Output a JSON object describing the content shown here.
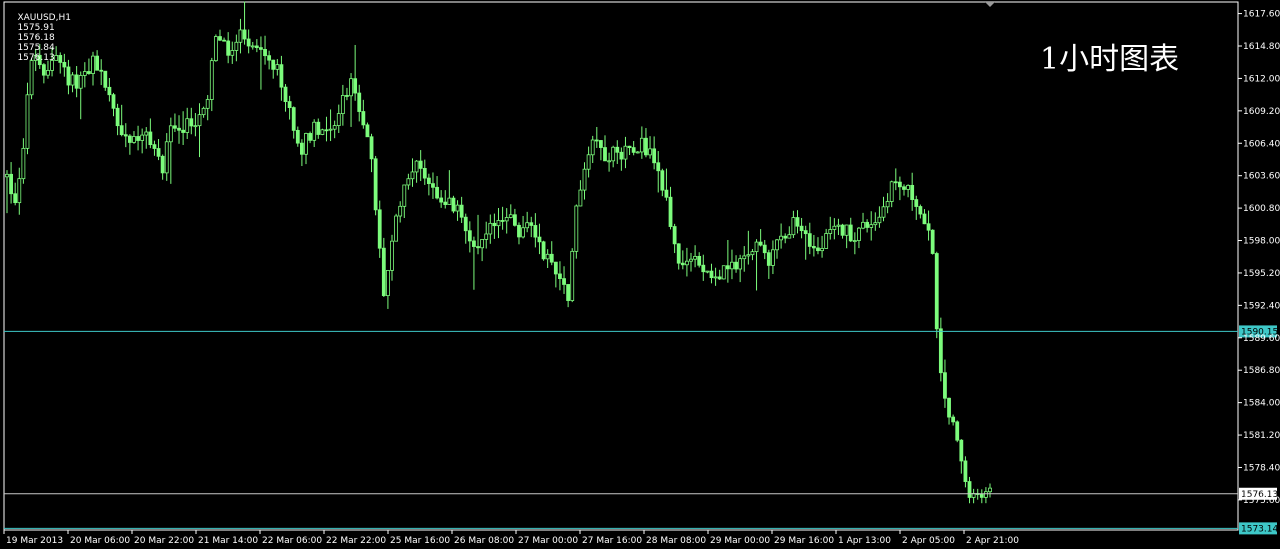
{
  "header": {
    "symbol": "XAUUSD,H1",
    "open": "1575.91",
    "high": "1576.18",
    "low": "1575.84",
    "close": "1576.13"
  },
  "caption": "1小时图表",
  "colors": {
    "background": "#000000",
    "candle": "#7cfc7c",
    "grid_frame": "#ffffff",
    "hline": "#3ec8c8",
    "bid_line": "#c8c8c8",
    "label_bg": "#3ec8c8"
  },
  "chart_data": {
    "type": "candlestick",
    "title": "",
    "symbol": "XAUUSD",
    "timeframe": "H1",
    "ylim": [
      1573.0,
      1618.6
    ],
    "y_ticks": [
      "1617.60",
      "1614.80",
      "1612.00",
      "1609.20",
      "1606.40",
      "1603.60",
      "1600.80",
      "1598.00",
      "1595.20",
      "1592.40",
      "1589.60",
      "1586.80",
      "1584.00",
      "1581.20",
      "1578.40",
      "1575.60"
    ],
    "x_ticks": [
      "19 Mar 2013",
      "20 Mar 06:00",
      "20 Mar 22:00",
      "21 Mar 14:00",
      "22 Mar 06:00",
      "22 Mar 22:00",
      "25 Mar 16:00",
      "26 Mar 08:00",
      "27 Mar 00:00",
      "27 Mar 16:00",
      "28 Mar 08:00",
      "29 Mar 00:00",
      "29 Mar 16:00",
      "1 Apr 13:00",
      "2 Apr 05:00",
      "2 Apr 21:00"
    ],
    "horizontal_lines": [
      {
        "value": 1590.15,
        "label": "1590.15"
      },
      {
        "value": 1573.14,
        "label": "1573.14"
      }
    ],
    "bid_line": {
      "value": 1576.13,
      "label": "1576.13"
    },
    "price_path": [
      [
        0,
        1603.5
      ],
      [
        2,
        1601.5
      ],
      [
        4,
        1606.0
      ],
      [
        6,
        1614.0
      ],
      [
        9,
        1612.0
      ],
      [
        12,
        1614.5
      ],
      [
        15,
        1611.5
      ],
      [
        18,
        1612.0
      ],
      [
        21,
        1613.5
      ],
      [
        24,
        1611.5
      ],
      [
        27,
        1608.0
      ],
      [
        30,
        1606.5
      ],
      [
        33,
        1607.5
      ],
      [
        36,
        1605.5
      ],
      [
        38,
        1604.5
      ],
      [
        40,
        1608.0
      ],
      [
        43,
        1607.5
      ],
      [
        46,
        1608.5
      ],
      [
        49,
        1610.5
      ],
      [
        51,
        1616.0
      ],
      [
        54,
        1614.0
      ],
      [
        57,
        1615.5
      ],
      [
        60,
        1614.5
      ],
      [
        63,
        1613.5
      ],
      [
        66,
        1612.5
      ],
      [
        69,
        1609.0
      ],
      [
        72,
        1606.0
      ],
      [
        75,
        1608.0
      ],
      [
        78,
        1607.5
      ],
      [
        81,
        1609.0
      ],
      [
        84,
        1612.0
      ],
      [
        87,
        1608.5
      ],
      [
        89,
        1604.5
      ],
      [
        91,
        1597.0
      ],
      [
        92,
        1593.5
      ],
      [
        94,
        1597.5
      ],
      [
        96,
        1601.5
      ],
      [
        98,
        1604.0
      ],
      [
        101,
        1604.5
      ],
      [
        104,
        1602.5
      ],
      [
        107,
        1601.5
      ],
      [
        110,
        1600.5
      ],
      [
        113,
        1598.5
      ],
      [
        116,
        1597.5
      ],
      [
        119,
        1599.5
      ],
      [
        122,
        1600.5
      ],
      [
        125,
        1598.5
      ],
      [
        128,
        1599.5
      ],
      [
        131,
        1597.0
      ],
      [
        134,
        1595.5
      ],
      [
        137,
        1593.5
      ],
      [
        139,
        1600.5
      ],
      [
        141,
        1604.5
      ],
      [
        143,
        1607.0
      ],
      [
        146,
        1605.5
      ],
      [
        149,
        1605.5
      ],
      [
        152,
        1606.0
      ],
      [
        155,
        1606.5
      ],
      [
        158,
        1605.0
      ],
      [
        161,
        1601.5
      ],
      [
        163,
        1597.5
      ],
      [
        165,
        1595.5
      ],
      [
        168,
        1596.5
      ],
      [
        171,
        1595.5
      ],
      [
        174,
        1595.0
      ],
      [
        177,
        1596.0
      ],
      [
        180,
        1596.5
      ],
      [
        183,
        1597.5
      ],
      [
        186,
        1596.5
      ],
      [
        189,
        1598.5
      ],
      [
        192,
        1599.5
      ],
      [
        195,
        1598.0
      ],
      [
        198,
        1597.0
      ],
      [
        201,
        1598.5
      ],
      [
        204,
        1599.0
      ],
      [
        207,
        1598.5
      ],
      [
        210,
        1599.5
      ],
      [
        213,
        1600.0
      ],
      [
        216,
        1603.0
      ],
      [
        219,
        1602.5
      ],
      [
        222,
        1601.5
      ],
      [
        224,
        1599.0
      ],
      [
        226,
        1597.5
      ],
      [
        227,
        1590.0
      ],
      [
        228,
        1586.0
      ],
      [
        230,
        1583.0
      ],
      [
        232,
        1580.5
      ],
      [
        234,
        1577.0
      ],
      [
        236,
        1576.0
      ],
      [
        238,
        1575.8
      ],
      [
        240,
        1576.1
      ]
    ]
  }
}
